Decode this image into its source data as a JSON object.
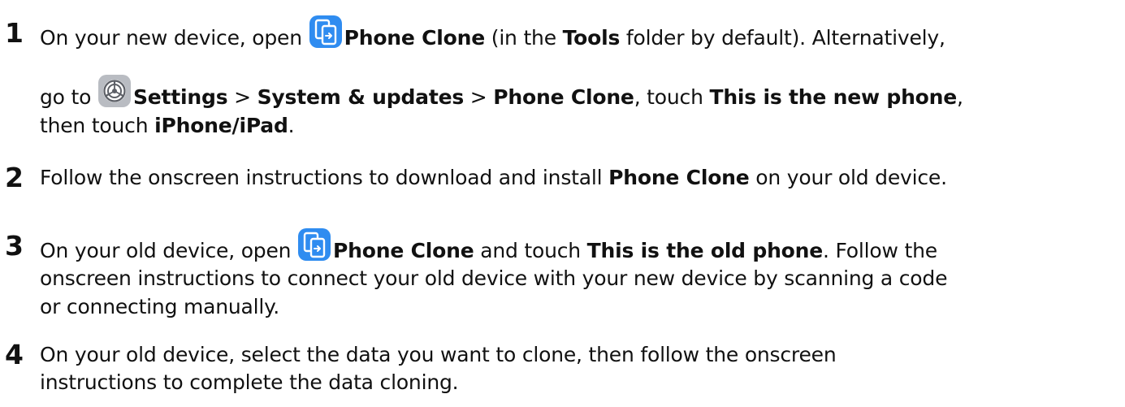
{
  "steps": [
    {
      "number": "1",
      "lines": [
        {
          "pre": "On your new device, open ",
          "icon": "phone-clone-icon",
          "b1": "Phone Clone",
          "t1": " (in the ",
          "b2": "Tools",
          "t2": " folder by default). Alternatively,"
        },
        {
          "pre": "go to ",
          "icon": "settings-icon",
          "b1": "Settings",
          "t1": " > ",
          "b2": "System & updates",
          "t2": " > ",
          "b3": "Phone Clone",
          "t3": ", touch ",
          "b4": "This is the new phone",
          "t4": ","
        },
        {
          "pre": "then touch ",
          "b1": "iPhone/iPad",
          "t1": "."
        }
      ]
    },
    {
      "number": "2",
      "lines": [
        {
          "pre": "Follow the onscreen instructions to download and install ",
          "b1": "Phone Clone",
          "t1": " on your old device."
        }
      ]
    },
    {
      "number": "3",
      "lines": [
        {
          "pre": "On your old device, open ",
          "icon": "phone-clone-icon",
          "b1": "Phone Clone",
          "t1": " and touch ",
          "b2": "This is the old phone",
          "t2": ". Follow the"
        },
        {
          "pre": "onscreen instructions to connect your old device with your new device by scanning a code"
        },
        {
          "pre": "or connecting manually."
        }
      ]
    },
    {
      "number": "4",
      "lines": [
        {
          "pre": "On your old device, select the data you want to clone, then follow the onscreen"
        },
        {
          "pre": "instructions to complete the data cloning."
        }
      ]
    }
  ],
  "colors": {
    "text": "#111111",
    "phone_clone_icon_bg": "#2f8cf0",
    "settings_icon_bg": "#8d8f94"
  }
}
